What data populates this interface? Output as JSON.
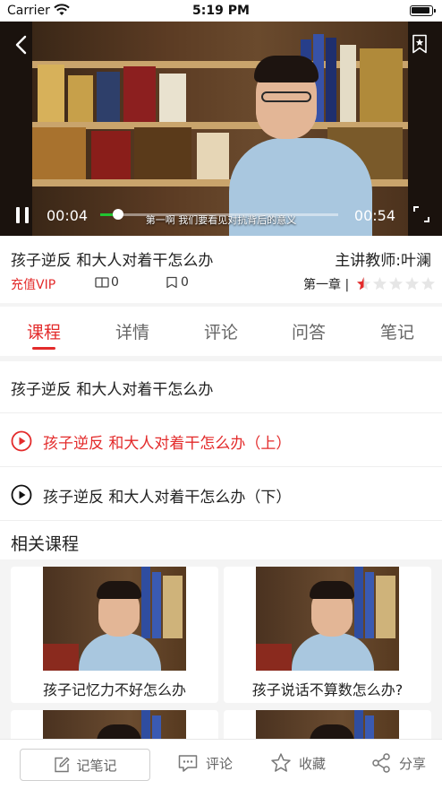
{
  "status_bar": {
    "carrier": "Carrier",
    "time": "5:19 PM"
  },
  "player": {
    "current_time": "00:04",
    "duration": "00:54",
    "progress": 0.074,
    "subtitle": "第一啊 我们要看见对抗背后的意义"
  },
  "course": {
    "title": "孩子逆反 和大人对着干怎么办",
    "teacher": "主讲教师:叶澜",
    "vip_label": "充值VIP",
    "chapter_count": "0",
    "bookmark_count": "0",
    "chapter_label": "第一章 |",
    "rating": 0.5,
    "rating_max": 5
  },
  "tabs": [
    {
      "label": "课程",
      "active": true
    },
    {
      "label": "详情",
      "active": false
    },
    {
      "label": "评论",
      "active": false
    },
    {
      "label": "问答",
      "active": false
    },
    {
      "label": "笔记",
      "active": false
    }
  ],
  "lessons": {
    "header": "孩子逆反 和大人对着干怎么办",
    "items": [
      {
        "label": "孩子逆反 和大人对着干怎么办（上）",
        "active": true
      },
      {
        "label": "孩子逆反 和大人对着干怎么办（下）",
        "active": false
      }
    ]
  },
  "related": {
    "title": "相关课程",
    "cards": [
      {
        "caption": "孩子记忆力不好怎么办"
      },
      {
        "caption": "孩子说话不算数怎么办?"
      },
      {
        "caption": ""
      },
      {
        "caption": ""
      }
    ]
  },
  "bottom_bar": {
    "note": "记笔记",
    "comment": "评论",
    "favorite": "收藏",
    "share": "分享"
  },
  "colors": {
    "accent": "#e32b2b",
    "progress": "#21c431"
  }
}
